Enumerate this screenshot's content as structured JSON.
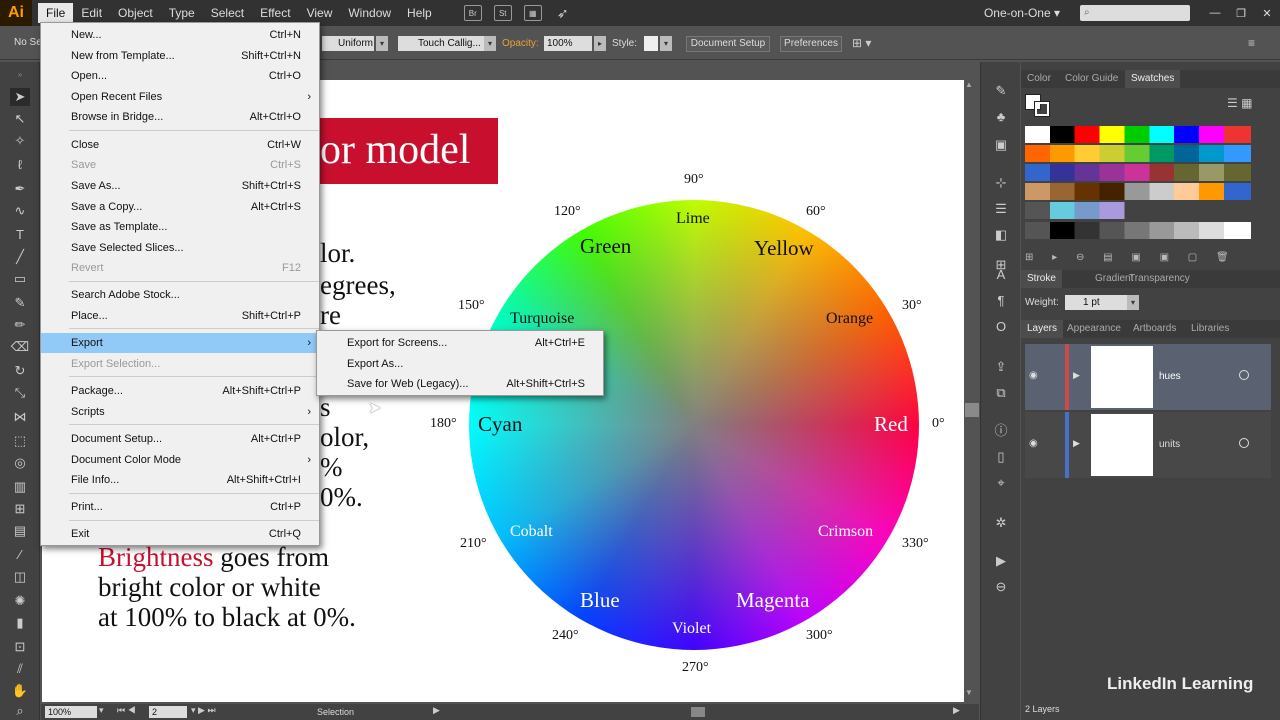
{
  "menubar": {
    "logo": "Ai",
    "items": [
      "File",
      "Edit",
      "Object",
      "Type",
      "Select",
      "Effect",
      "View",
      "Window",
      "Help"
    ],
    "br_icon": "Br",
    "st_icon": "St",
    "workspace": "One-on-One"
  },
  "controlbar": {
    "no_selection": "No Se",
    "stroke_style": "Uniform",
    "brush": "Touch Callig...",
    "opacity_label": "Opacity:",
    "opacity_value": "100%",
    "style_label": "Style:",
    "doc_setup": "Document Setup",
    "preferences": "Preferences"
  },
  "file_menu": {
    "items": [
      {
        "label": "New...",
        "shortcut": "Ctrl+N"
      },
      {
        "label": "New from Template...",
        "shortcut": "Shift+Ctrl+N"
      },
      {
        "label": "Open...",
        "shortcut": "Ctrl+O"
      },
      {
        "label": "Open Recent Files",
        "shortcut": "›"
      },
      {
        "label": "Browse in Bridge...",
        "shortcut": "Alt+Ctrl+O"
      },
      {
        "label": "Close",
        "shortcut": "Ctrl+W"
      },
      {
        "label": "Save",
        "shortcut": "Ctrl+S"
      },
      {
        "label": "Save As...",
        "shortcut": "Shift+Ctrl+S"
      },
      {
        "label": "Save a Copy...",
        "shortcut": "Alt+Ctrl+S"
      },
      {
        "label": "Save as Template...",
        "shortcut": ""
      },
      {
        "label": "Save Selected Slices...",
        "shortcut": ""
      },
      {
        "label": "Revert",
        "shortcut": "F12"
      },
      {
        "label": "Search Adobe Stock...",
        "shortcut": ""
      },
      {
        "label": "Place...",
        "shortcut": "Shift+Ctrl+P"
      },
      {
        "label": "Export",
        "shortcut": "›"
      },
      {
        "label": "Export Selection...",
        "shortcut": ""
      },
      {
        "label": "Package...",
        "shortcut": "Alt+Shift+Ctrl+P"
      },
      {
        "label": "Scripts",
        "shortcut": "›"
      },
      {
        "label": "Document Setup...",
        "shortcut": "Alt+Ctrl+P"
      },
      {
        "label": "Document Color Mode",
        "shortcut": "›"
      },
      {
        "label": "File Info...",
        "shortcut": "Alt+Shift+Ctrl+I"
      },
      {
        "label": "Print...",
        "shortcut": "Ctrl+P"
      },
      {
        "label": "Exit",
        "shortcut": "Ctrl+Q"
      }
    ]
  },
  "export_submenu": {
    "items": [
      {
        "label": "Export for Screens...",
        "shortcut": "Alt+Ctrl+E"
      },
      {
        "label": "Export As...",
        "shortcut": ""
      },
      {
        "label": "Save for Web (Legacy)...",
        "shortcut": "Alt+Shift+Ctrl+S"
      }
    ]
  },
  "artboard": {
    "title_fragment": "or model",
    "para_lines": [
      "lor.",
      "egrees,",
      "re",
      "s",
      "olor,",
      "%",
      "0%."
    ],
    "brightness_word": "Brightness",
    "brightness_rest": " goes from",
    "brightness_line2": "bright color or white",
    "brightness_line3": "at 100% to black at 0%.",
    "hues": [
      "Red",
      "Orange",
      "Yellow",
      "Lime",
      "Green",
      "Turquoise",
      "Cyan",
      "Cobalt",
      "Blue",
      "Violet",
      "Magenta",
      "Crimson"
    ],
    "degrees": [
      "0°",
      "30°",
      "60°",
      "90°",
      "120°",
      "150°",
      "180°",
      "210°",
      "240°",
      "270°",
      "300°",
      "330°"
    ]
  },
  "panels": {
    "color_tabs": [
      "Color",
      "Color Guide",
      "Swatches"
    ],
    "stroke_tabs": [
      "Stroke",
      "Gradient",
      "Transparency"
    ],
    "weight_label": "Weight:",
    "weight_value": "1 pt",
    "layer_tabs": [
      "Layers",
      "Appearance",
      "Artboards",
      "Libraries"
    ],
    "layers": [
      "hues",
      "units"
    ],
    "layer_count": "2 Layers"
  },
  "statusbar": {
    "zoom": "100%",
    "artboard_num": "2",
    "tool_status": "Selection"
  },
  "watermark": "LinkedIn Learning",
  "colors": {
    "title_red": "#c8102e",
    "menu_highlight": "#91c9f7",
    "accent_red_text": "#c8102e"
  }
}
